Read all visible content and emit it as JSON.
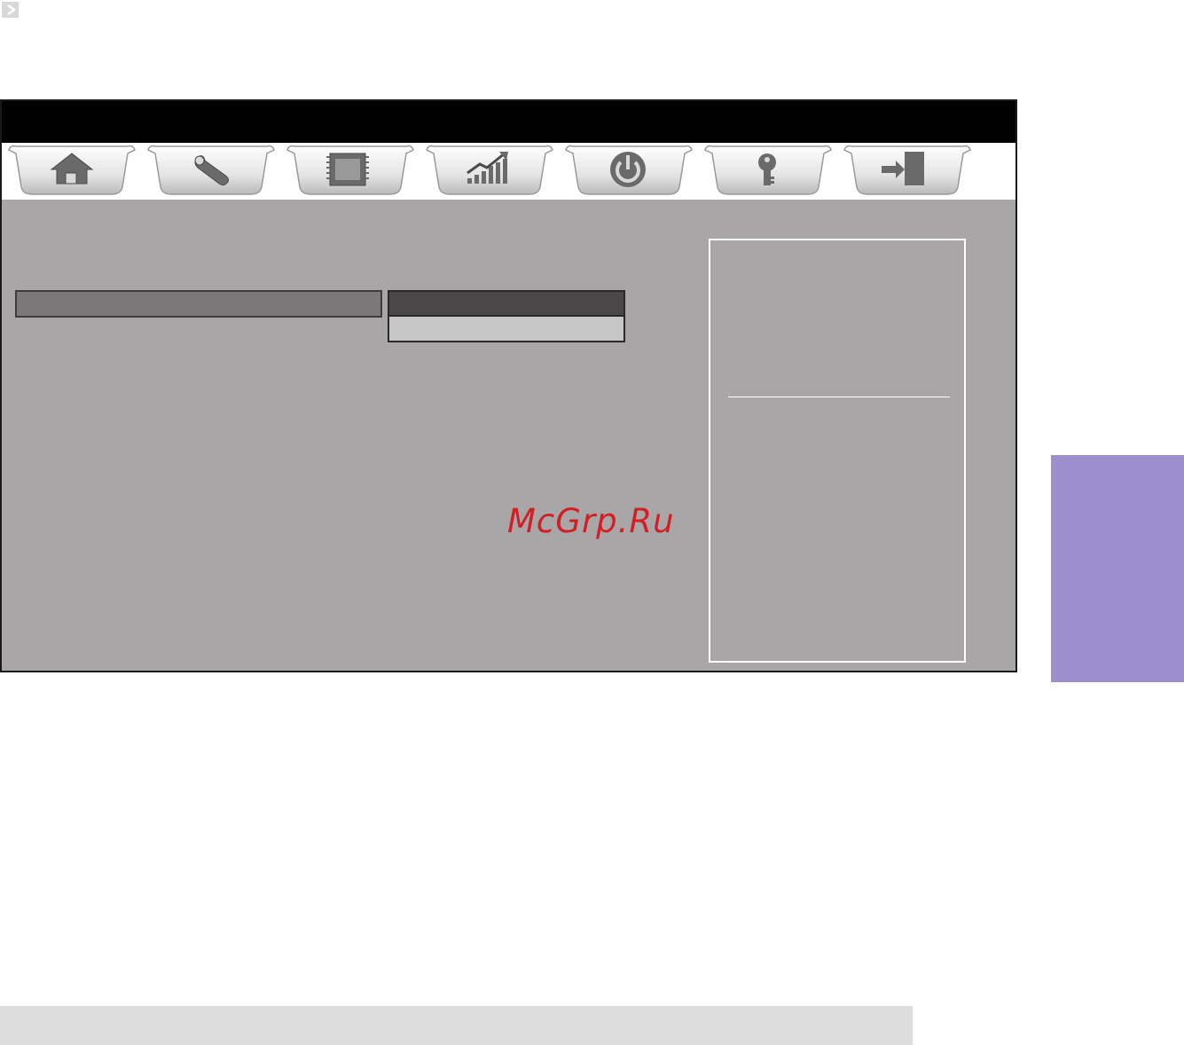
{
  "corner_icon": "chevron-right-icon",
  "tabs": [
    {
      "icon": "home-icon"
    },
    {
      "icon": "wrench-icon"
    },
    {
      "icon": "chip-icon"
    },
    {
      "icon": "performance-chart-icon"
    },
    {
      "icon": "power-icon"
    },
    {
      "icon": "key-icon"
    },
    {
      "icon": "exit-icon"
    }
  ],
  "watermark": {
    "text": "McGrp.Ru"
  },
  "colors": {
    "title_bar": "#000000",
    "panel_bg": "#a8a6a7",
    "item_row": "#7a7879",
    "option_selected": "#4a4748",
    "option_normal": "#c8c7c8",
    "side_tab": "#9d8ecf",
    "footer_bar": "#dddddd",
    "watermark": "#d21f26"
  }
}
